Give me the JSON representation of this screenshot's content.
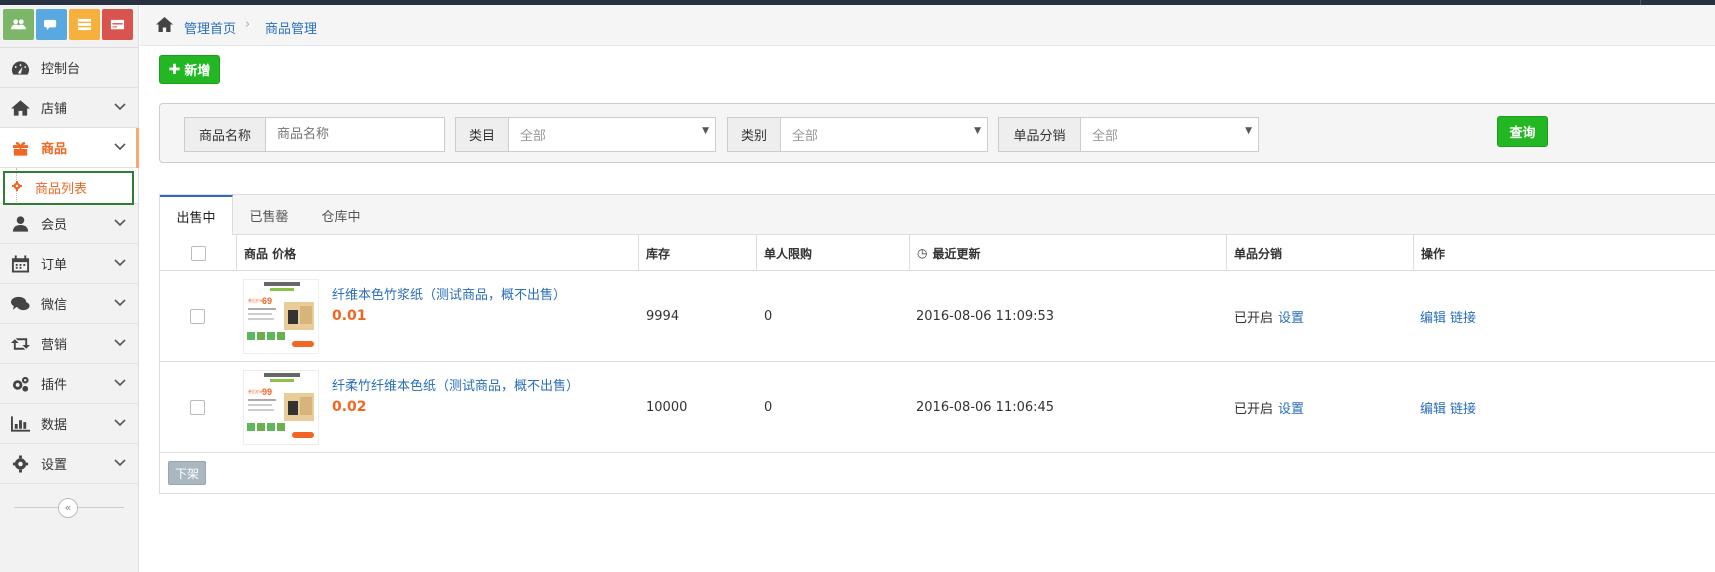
{
  "colors": {
    "accent": "#f26522",
    "link": "#2a6ebb",
    "primary_green": "#23b823",
    "shortcut_green": "#7cb668",
    "shortcut_blue": "#5aa8e0",
    "shortcut_orange": "#f8b03d",
    "shortcut_red": "#d9534f"
  },
  "shortcuts": [
    "users-icon",
    "chat-icon",
    "list-icon",
    "card-icon"
  ],
  "sidebar": {
    "items": [
      {
        "label": "控制台",
        "icon": "dashboard-icon"
      },
      {
        "label": "店铺",
        "icon": "home-icon"
      },
      {
        "label": "商品",
        "icon": "gift-icon",
        "active": true
      },
      {
        "label": "会员",
        "icon": "user-icon"
      },
      {
        "label": "订单",
        "icon": "calendar-icon"
      },
      {
        "label": "微信",
        "icon": "comments-icon"
      },
      {
        "label": "营销",
        "icon": "retweet-icon"
      },
      {
        "label": "插件",
        "icon": "cogs-icon"
      },
      {
        "label": "数据",
        "icon": "bar-chart-icon"
      },
      {
        "label": "设置",
        "icon": "gear-icon"
      }
    ],
    "submenu_label": "商品列表",
    "collapse_icon": "«"
  },
  "breadcrumb": {
    "home": "管理首页",
    "sep": "›",
    "current": "商品管理"
  },
  "add_button": "新增",
  "filter": {
    "name_label": "商品名称",
    "name_placeholder": "商品名称",
    "category_label": "类目",
    "category_value": "全部",
    "type_label": "类别",
    "type_value": "全部",
    "distribution_label": "单品分销",
    "distribution_value": "全部",
    "query_button": "查询"
  },
  "tabs": [
    "出售中",
    "已售罄",
    "仓库中"
  ],
  "table": {
    "headers": {
      "product": "商品 价格",
      "stock": "库存",
      "limit": "单人限购",
      "updated": "最近更新",
      "distribution": "单品分销",
      "actions": "操作"
    },
    "rows": [
      {
        "name": "纤维本色竹浆纸（测试商品，概不出售）",
        "price": "0.01",
        "stock": "9994",
        "limit": "0",
        "updated": "2016-08-06 11:09:53",
        "dist_status": "已开启",
        "dist_link": "设置",
        "edit": "编辑",
        "link": "链接",
        "thumb_price": "69"
      },
      {
        "name": "纤柔竹纤维本色纸（测试商品，概不出售）",
        "price": "0.02",
        "stock": "10000",
        "limit": "0",
        "updated": "2016-08-06 11:06:45",
        "dist_status": "已开启",
        "dist_link": "设置",
        "edit": "编辑",
        "link": "链接",
        "thumb_price": "99"
      }
    ]
  },
  "offshelf_button": "下架"
}
